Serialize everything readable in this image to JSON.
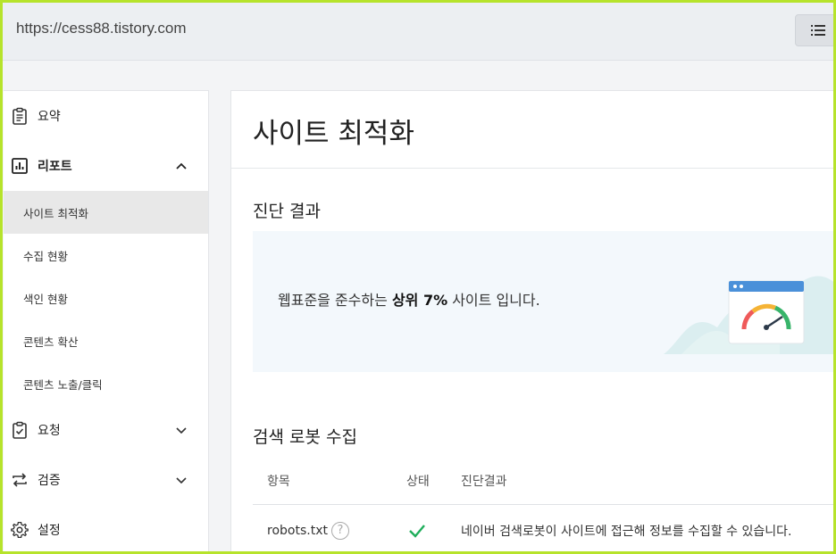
{
  "browser": {
    "url": "https://cess88.tistory.com"
  },
  "sidebar": {
    "items": [
      {
        "label": "요약",
        "icon": "clipboard-icon"
      },
      {
        "label": "리포트",
        "icon": "bar-chart-icon",
        "expanded": true,
        "children": [
          {
            "label": "사이트 최적화",
            "active": true
          },
          {
            "label": "수집 현황"
          },
          {
            "label": "색인 현황"
          },
          {
            "label": "콘텐츠 확산"
          },
          {
            "label": "콘텐츠 노출/클릭"
          }
        ]
      },
      {
        "label": "요청",
        "icon": "clipboard-check-icon",
        "expanded": false
      },
      {
        "label": "검증",
        "icon": "swap-icon",
        "expanded": false
      },
      {
        "label": "설정",
        "icon": "gear-icon"
      }
    ]
  },
  "main": {
    "title": "사이트 최적화",
    "diagnosis": {
      "heading": "진단 결과",
      "text_before": "웹표준을 준수하는 ",
      "text_bold": "상위 7%",
      "text_after": " 사이트 입니다."
    },
    "robot": {
      "heading": "검색 로봇 수집",
      "columns": [
        "항목",
        "상태",
        "진단결과"
      ],
      "rows": [
        {
          "item": "robots.txt",
          "help": "?",
          "status": "ok",
          "result": "네이버 검색로봇이 사이트에 접근해 정보를 수집할 수 있습니다."
        }
      ]
    }
  },
  "colors": {
    "accent_green": "#1fae5b",
    "frame": "#b6e32b"
  }
}
